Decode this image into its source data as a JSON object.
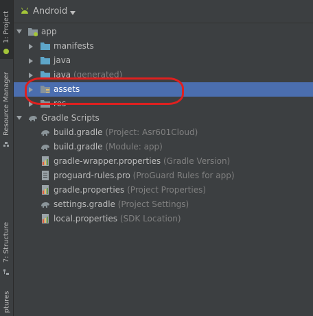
{
  "side_tabs": {
    "project": "1: Project",
    "resource_manager": "Resource Manager",
    "structure": "7: Structure",
    "captures": "ptures"
  },
  "toolbar": {
    "view_mode": "Android"
  },
  "tree": [
    {
      "label": "app",
      "sub": "",
      "icon": "module-folder-icon",
      "expand": "down",
      "indent": 0
    },
    {
      "label": "manifests",
      "sub": "",
      "icon": "folder-icon",
      "expand": "right",
      "indent": 1
    },
    {
      "label": "java",
      "sub": "",
      "icon": "folder-icon",
      "expand": "right",
      "indent": 1
    },
    {
      "label": "java",
      "sub": "(generated)",
      "icon": "folder-icon",
      "expand": "right",
      "indent": 1
    },
    {
      "label": "assets",
      "sub": "",
      "icon": "assets-folder-icon",
      "expand": "right",
      "indent": 1,
      "selected": true
    },
    {
      "label": "res",
      "sub": "",
      "icon": "res-folder-icon",
      "expand": "right",
      "indent": 1
    },
    {
      "label": "Gradle Scripts",
      "sub": "",
      "icon": "gradle-elephant-icon",
      "expand": "down",
      "indent": 0
    },
    {
      "label": "build.gradle",
      "sub": "(Project: Asr601Cloud)",
      "icon": "gradle-elephant-icon",
      "expand": "",
      "indent": 1
    },
    {
      "label": "build.gradle",
      "sub": "(Module: app)",
      "icon": "gradle-elephant-icon",
      "expand": "",
      "indent": 1
    },
    {
      "label": "gradle-wrapper.properties",
      "sub": "(Gradle Version)",
      "icon": "properties-file-icon",
      "expand": "",
      "indent": 1
    },
    {
      "label": "proguard-rules.pro",
      "sub": "(ProGuard Rules for app)",
      "icon": "text-file-icon",
      "expand": "",
      "indent": 1
    },
    {
      "label": "gradle.properties",
      "sub": "(Project Properties)",
      "icon": "properties-file-icon",
      "expand": "",
      "indent": 1
    },
    {
      "label": "settings.gradle",
      "sub": "(Project Settings)",
      "icon": "gradle-elephant-icon",
      "expand": "",
      "indent": 1
    },
    {
      "label": "local.properties",
      "sub": "(SDK Location)",
      "icon": "properties-file-icon",
      "expand": "",
      "indent": 1
    }
  ],
  "colors": {
    "selection": "#4b6eaf",
    "annotation": "#e0201f",
    "android_green": "#a4c639",
    "folder_blue": "#5ea6c9"
  }
}
